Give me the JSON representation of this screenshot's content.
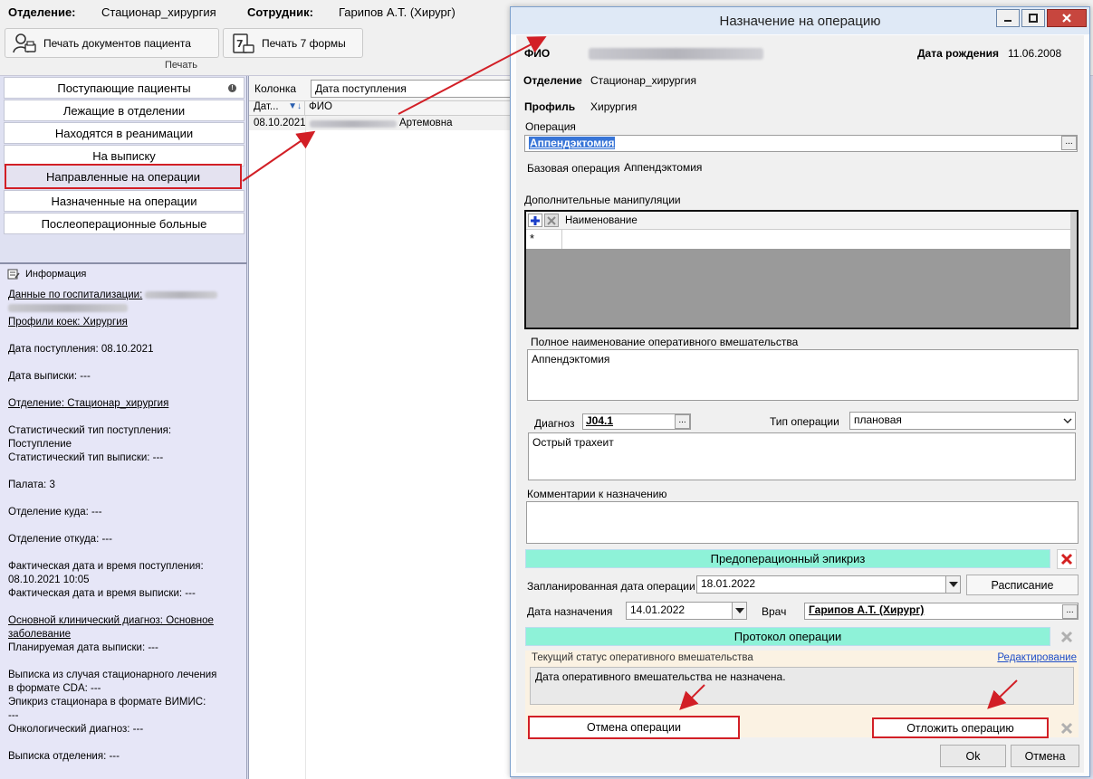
{
  "header": {
    "department_label": "Отделение:",
    "department_value": "Стационар_хирургия",
    "employee_label": "Сотрудник:",
    "employee_value": "Гарипов А.Т. (Хирург)"
  },
  "toolbar": {
    "print_docs_label": "Печать документов пациента",
    "print_form7_label": "Печать 7 формы",
    "group_label": "Печать"
  },
  "nav": {
    "items": [
      {
        "label": "Поступающие пациенты"
      },
      {
        "label": "Лежащие в отделении"
      },
      {
        "label": "Находятся в реанимации"
      },
      {
        "label": "На выписку"
      },
      {
        "label": "Направленные на операции"
      },
      {
        "label": "Назначенные на операции"
      },
      {
        "label": "Послеоперационные больные"
      }
    ],
    "badge": "!"
  },
  "info": {
    "title": "Информация",
    "hosp_data": "Данные по госпитализации:",
    "bed_profiles": "Профили коек: Хирургия",
    "admission_date": "Дата поступления: 08.10.2021",
    "discharge_date": "Дата выписки: ---",
    "department": "Отделение: Стационар_хирургия",
    "stat_type_in_1": "Статистический тип поступления:",
    "stat_type_in_2": "Поступление",
    "stat_type_out": "Статистический тип выписки: ---",
    "ward": "Палата: 3",
    "dept_to": "Отделение куда: ---",
    "dept_from": "Отделение откуда: ---",
    "actual_admission_1": "Фактическая дата и время поступления:",
    "actual_admission_2": "08.10.2021 10:05",
    "actual_discharge": "Фактическая дата и время выписки: ---",
    "diagnosis_1": "Основной клинический диагноз: Основное",
    "diagnosis_2": "заболевание",
    "planned_discharge": "Планируемая дата выписки: ---",
    "cda_1": "Выписка из случая стационарного лечения",
    "cda_2": "в формате CDA: ---",
    "vimis_1": "Эпикриз стационара в формате ВИМИС:",
    "vimis_2": "---",
    "onco": "Онкологический диагноз: ---",
    "dept_extract": "Выписка отделения: ---"
  },
  "grid": {
    "filter_label": "Колонка",
    "filter_value": "Дата поступления",
    "col_date": "Дат...",
    "col_fio": "ФИО",
    "rows": [
      {
        "date": "08.10.2021",
        "fio_tail": "Артемовна"
      }
    ]
  },
  "dialog": {
    "title": "Назначение на операцию",
    "fio_label": "ФИО",
    "birth_label": "Дата рождения",
    "birth_value": "11.06.2008",
    "dept_label": "Отделение",
    "dept_value": "Стационар_хирургия",
    "profile_label": "Профиль",
    "profile_value": "Хирургия",
    "operation_label": "Операция",
    "operation_value": "Аппендэктомия",
    "base_op_label": "Базовая операция",
    "base_op_value": "Аппендэктомия",
    "extra_label": "Дополнительные манипуляции",
    "extra_col_name": "Наименование",
    "full_name_label": "Полное наименование оперативного вмешательства",
    "full_name_value": "Аппендэктомия",
    "diagnosis_label": "Диагноз",
    "diagnosis_code": "J04.1",
    "op_type_label": "Тип операции",
    "op_type_value": "плановая",
    "diagnosis_text": "Острый трахеит",
    "comments_label": "Комментарии к назначению",
    "preop_label": "Предоперационный эпикриз",
    "planned_date_label": "Запланированная дата операции",
    "planned_date_value": "18.01.2022",
    "schedule_label": "Расписание",
    "assign_date_label": "Дата назначения",
    "assign_date_value": "14.01.2022",
    "doctor_label": "Врач",
    "doctor_value": "Гарипов А.Т. (Хирург)",
    "protocol_label": "Протокол операции",
    "status_label": "Текущий статус оперативного вмешательства",
    "edit_link": "Редактирование",
    "status_value": "Дата оперативного вмешательства не назначена.",
    "cancel_op_label": "Отмена операции",
    "postpone_label": "Отложить операцию",
    "ok_label": "Ok",
    "cancel_label": "Отмена"
  },
  "colors": {
    "highlight_red": "#d21f26",
    "green_bar": "#8ef2d8",
    "nav_bg": "#dfe1f2",
    "info_bg": "#e6e6f7"
  }
}
